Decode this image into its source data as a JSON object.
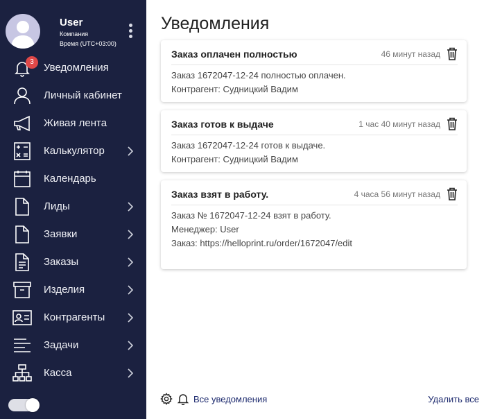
{
  "user": {
    "name": "User",
    "company": "Компания",
    "timezone": "Время (UTC+03:00)"
  },
  "sidebar": {
    "items": [
      {
        "label": "Уведомления",
        "icon": "bell-icon",
        "badge": "3",
        "has_submenu": false
      },
      {
        "label": "Личный кабинет",
        "icon": "user-icon",
        "has_submenu": false
      },
      {
        "label": "Живая лента",
        "icon": "megaphone-icon",
        "has_submenu": false
      },
      {
        "label": "Калькулятор",
        "icon": "calculator-icon",
        "has_submenu": true
      },
      {
        "label": "Календарь",
        "icon": "calendar-icon",
        "has_submenu": false
      },
      {
        "label": "Лиды",
        "icon": "file-icon",
        "has_submenu": true
      },
      {
        "label": "Заявки",
        "icon": "file-icon",
        "has_submenu": true
      },
      {
        "label": "Заказы",
        "icon": "file-text-icon",
        "has_submenu": true
      },
      {
        "label": "Изделия",
        "icon": "archive-icon",
        "has_submenu": true
      },
      {
        "label": "Контрагенты",
        "icon": "id-card-icon",
        "has_submenu": true
      },
      {
        "label": "Задачи",
        "icon": "lines-icon",
        "has_submenu": true
      },
      {
        "label": "Касса",
        "icon": "hierarchy-icon",
        "has_submenu": true
      }
    ]
  },
  "main": {
    "title": "Уведомления",
    "notifications": [
      {
        "title": "Заказ оплачен полностью",
        "time": "46 минут назад",
        "lines": [
          "Заказ 1672047-12-24 полностью оплачен.",
          "Контрагент: Судницкий Вадим"
        ]
      },
      {
        "title": "Заказ готов к выдаче",
        "time": "1 час 40 минут назад",
        "lines": [
          "Заказ 1672047-12-24 готов к выдаче.",
          "Контрагент: Судницкий Вадим"
        ]
      },
      {
        "title": "Заказ взят в работу.",
        "time": "4 часа 56 минут назад",
        "lines": [
          "Заказ № 1672047-12-24 взят в работу.",
          "Менеджер: User",
          "Заказ: https://helloprint.ru/order/1672047/edit"
        ]
      }
    ],
    "footer": {
      "all_label": "Все уведомления",
      "delete_all_label": "Удалить все"
    }
  },
  "colors": {
    "sidebar_bg": "#1b2140",
    "badge": "#e04848",
    "link": "#1d2a6e"
  }
}
